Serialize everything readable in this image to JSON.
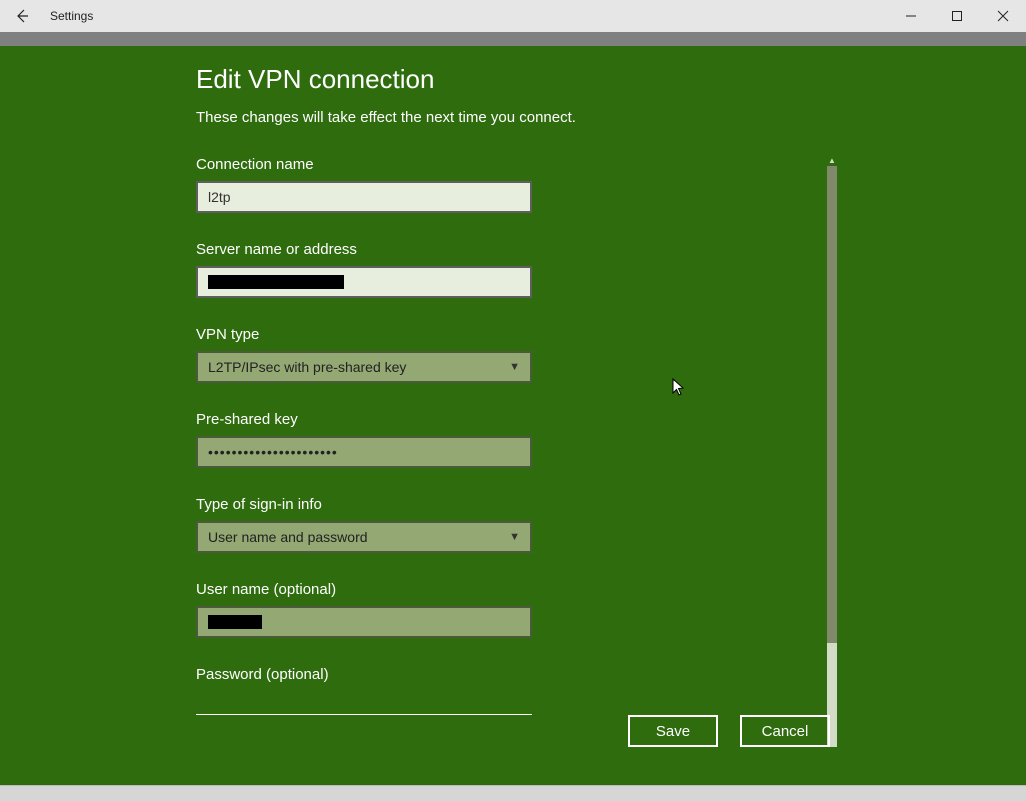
{
  "window": {
    "title": "Settings",
    "back_icon": "←",
    "minimize": "—",
    "maximize": "▢",
    "close": "✕"
  },
  "overlay": {
    "title": "Edit VPN connection",
    "subtitle": "These changes will take effect the next time you connect.",
    "labels": {
      "conn_name": "Connection name",
      "server": "Server name or address",
      "vpn_type": "VPN type",
      "psk": "Pre-shared key",
      "signin_type": "Type of sign-in info",
      "username": "User name (optional)",
      "password": "Password (optional)"
    },
    "values": {
      "conn_name": "l2tp",
      "server": "",
      "vpn_type": "L2TP/IPsec with pre-shared key",
      "psk": "••••••••••••••••••••••",
      "signin_type": "User name and password",
      "username": "",
      "password": ""
    },
    "buttons": {
      "save": "Save",
      "cancel": "Cancel"
    }
  }
}
